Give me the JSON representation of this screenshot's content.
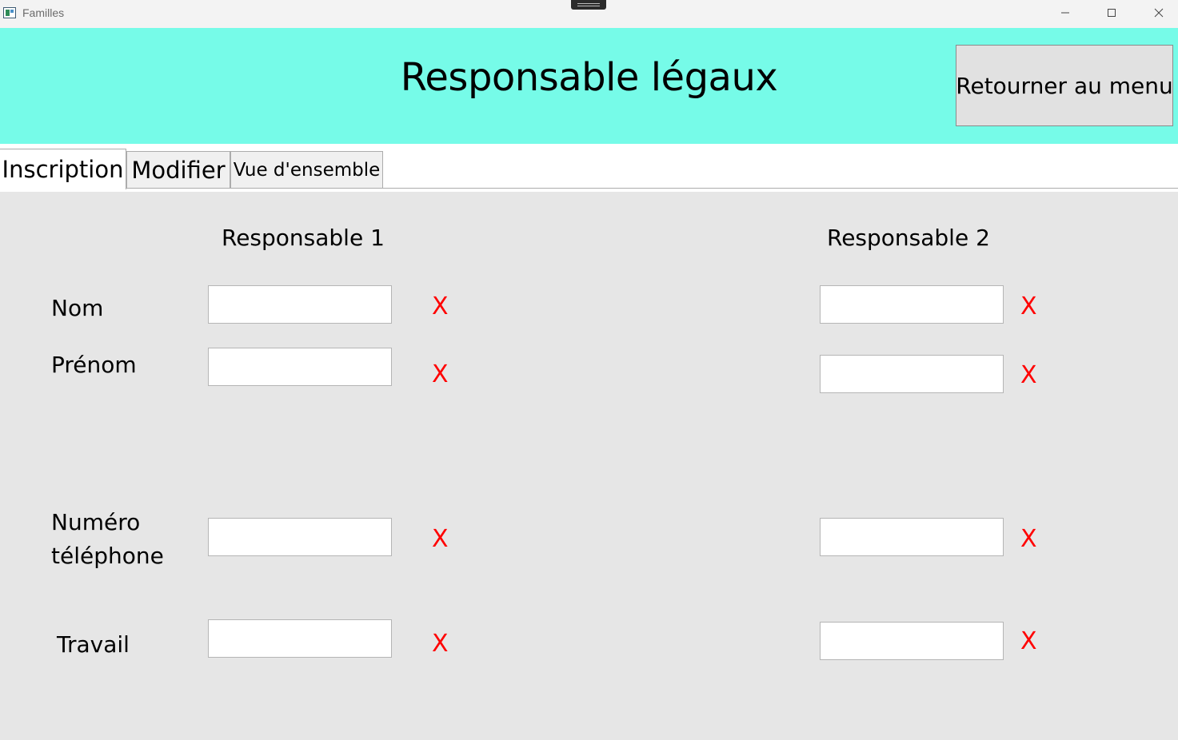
{
  "window": {
    "title": "Familles",
    "minimize_glyph": "—",
    "maximize_glyph": "☐",
    "close_glyph": "✕"
  },
  "header": {
    "title": "Responsable légaux",
    "back_button": "Retourner au menu",
    "background": "#76fbe8"
  },
  "tabs": [
    {
      "label": "Inscription",
      "selected": true
    },
    {
      "label": "Modifier",
      "selected": false
    },
    {
      "label": "Vue d'ensemble",
      "selected": false
    }
  ],
  "form": {
    "columns": [
      "Responsable 1",
      "Responsable 2"
    ],
    "rows": [
      {
        "label": "Nom"
      },
      {
        "label": "Prénom"
      },
      {
        "label_line1": "Numéro",
        "label_line2": "téléphone"
      },
      {
        "label": "Travail"
      }
    ],
    "invalid_marker": "X",
    "invalid_color": "#ff0000"
  }
}
